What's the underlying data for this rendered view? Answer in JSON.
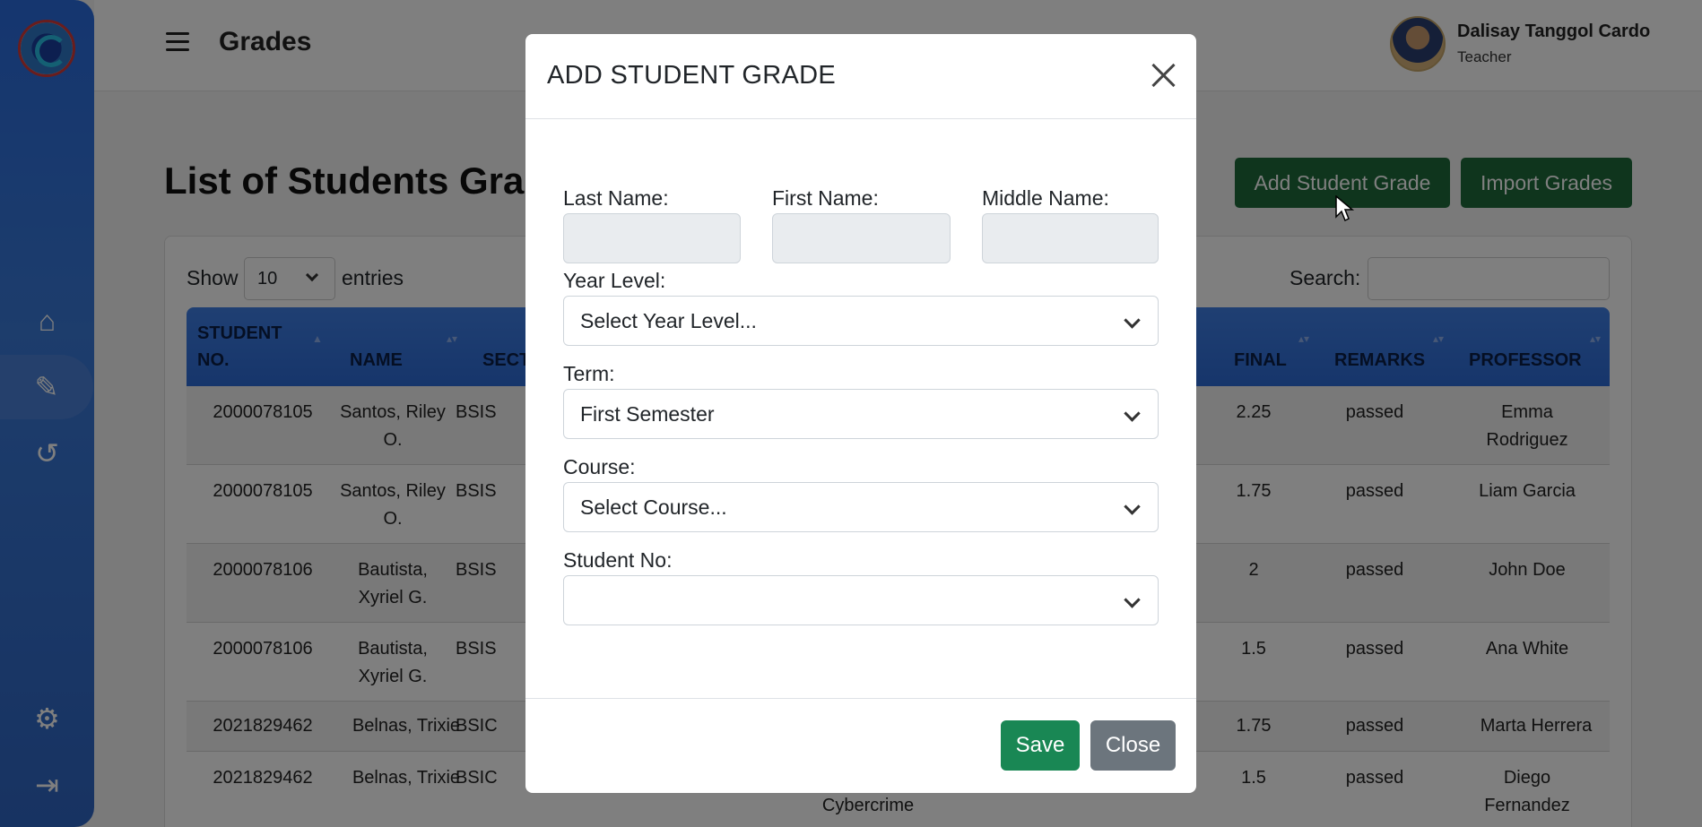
{
  "header": {
    "title": "Grades",
    "user_name": "Dalisay Tanggol Cardo",
    "user_role": "Teacher"
  },
  "sidebar": {
    "items": [
      {
        "icon": "home-icon",
        "glyph": "⌂"
      },
      {
        "icon": "grade-edit-icon",
        "glyph": "✎"
      },
      {
        "icon": "history-icon",
        "glyph": "↺"
      },
      {
        "icon": "gear-icon",
        "glyph": "⚙"
      },
      {
        "icon": "logout-icon",
        "glyph": "⇥"
      }
    ]
  },
  "main": {
    "title": "List of Students Grade",
    "add_button": "Add Student Grade",
    "import_button": "Import Grades",
    "show_label": "Show",
    "entries_value": "10",
    "entries_label": "entries",
    "search_label": "Search:"
  },
  "table": {
    "headers": {
      "student_no": "STUDENT NO.",
      "name": "NAME",
      "section": "SECT",
      "final": "FINAL",
      "remarks": "REMARKS",
      "professor": "PROFESSOR"
    },
    "rows": [
      {
        "student_no": "2000078105",
        "name": "Santos, Riley O.",
        "section": "BSIS",
        "final": "2.25",
        "remarks": "passed",
        "professor": "Emma Rodriguez"
      },
      {
        "student_no": "2000078105",
        "name": "Santos, Riley O.",
        "section": "BSIS",
        "final": "1.75",
        "remarks": "passed",
        "professor": "Liam Garcia"
      },
      {
        "student_no": "2000078106",
        "name": "Bautista, Xyriel G.",
        "section": "BSIS",
        "final": "2",
        "remarks": "passed",
        "professor": "John Doe"
      },
      {
        "student_no": "2000078106",
        "name": "Bautista, Xyriel G.",
        "section": "BSIS",
        "final": "1.5",
        "remarks": "passed",
        "professor": "Ana White"
      },
      {
        "student_no": "2021829462",
        "name": "Belnas, Trixie",
        "section": "BSIC",
        "final": "1.75",
        "remarks": "passed",
        "professor": "Marta Herrera"
      },
      {
        "student_no": "2021829462",
        "name": "Belnas, Trixie",
        "section": "BSIC",
        "course_fragment": "Cybercrime",
        "final": "1.5",
        "remarks": "passed",
        "professor": "Diego Fernandez"
      }
    ]
  },
  "modal": {
    "title": "ADD STUDENT GRADE",
    "last_name_label": "Last Name:",
    "first_name_label": "First Name:",
    "middle_name_label": "Middle Name:",
    "last_name_value": "",
    "first_name_value": "",
    "middle_name_value": "",
    "year_level_label": "Year Level:",
    "year_level_value": "Select Year Level...",
    "term_label": "Term:",
    "term_value": "First Semester",
    "course_label": "Course:",
    "course_value": "Select Course...",
    "student_no_label": "Student No:",
    "student_no_value": "",
    "save_button": "Save",
    "close_button": "Close"
  },
  "colors": {
    "primary_green": "#1e6b3a",
    "save_green": "#198754",
    "close_gray": "#6c757d",
    "sidebar_blue": "#2a6cdf",
    "table_header_blue": "#3f7fe6"
  }
}
